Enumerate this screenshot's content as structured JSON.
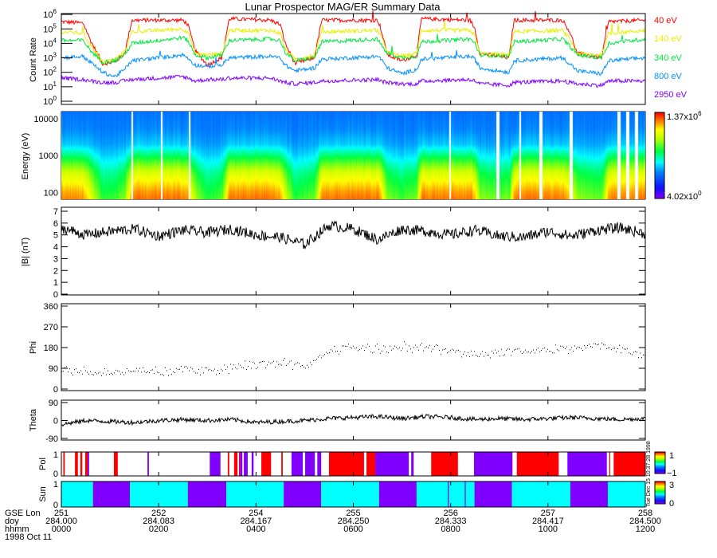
{
  "title": "Lunar Prospector MAG/ER Summary Data",
  "colors": {
    "red": "#ff0000",
    "yellow": "#e8f000",
    "green": "#00e840",
    "blue": "#0090ff",
    "purple": "#8000ff",
    "cyan": "#00ffff"
  },
  "chart_data": [
    {
      "type": "line",
      "ylabel": "Count Rate",
      "yscale": "log",
      "ylim": [
        1,
        1000000
      ],
      "ytick_base": "10",
      "ytick_exponents": [
        "0",
        "1",
        "2",
        "3",
        "4",
        "5",
        "6"
      ],
      "x_hours": [
        0,
        0.45,
        0.6,
        0.85,
        1.1,
        1.3,
        1.45,
        2.5,
        2.6,
        2.75,
        3.0,
        3.3,
        3.45,
        4.3,
        4.5,
        4.6,
        4.8,
        5.2,
        5.35,
        6.5,
        6.55,
        6.7,
        7.0,
        7.3,
        7.4,
        8.4,
        8.5,
        8.6,
        9.2,
        9.3,
        10.3,
        10.45,
        10.6,
        11.1,
        11.25,
        12
      ],
      "series": [
        {
          "name": "40 eV",
          "color": "#ff0000",
          "log10_values": [
            5.5,
            5.4,
            4.2,
            2.6,
            2.7,
            3.3,
            5.6,
            5.6,
            5.3,
            3.5,
            2.5,
            3.0,
            5.7,
            5.6,
            5.3,
            4.0,
            2.6,
            3.0,
            5.6,
            5.6,
            5.2,
            3.2,
            2.8,
            3.2,
            5.7,
            5.6,
            5.0,
            3.3,
            3.0,
            5.6,
            5.6,
            4.8,
            3.3,
            3.0,
            5.5,
            5.6
          ]
        },
        {
          "name": "140 eV",
          "color": "#e8f000",
          "log10_values": [
            4.8,
            4.7,
            3.9,
            2.7,
            2.9,
            3.4,
            4.8,
            5.0,
            4.8,
            3.3,
            3.2,
            3.3,
            4.9,
            4.9,
            4.7,
            3.6,
            2.9,
            3.2,
            4.8,
            4.9,
            4.6,
            3.4,
            3.1,
            3.3,
            4.9,
            4.9,
            4.5,
            3.3,
            3.2,
            4.8,
            4.9,
            4.3,
            3.3,
            3.2,
            4.7,
            4.9
          ]
        },
        {
          "name": "340 eV",
          "color": "#00e840",
          "log10_values": [
            4.2,
            4.2,
            3.5,
            2.7,
            2.8,
            3.2,
            4.0,
            4.4,
            4.2,
            3.2,
            3.0,
            3.2,
            4.2,
            4.3,
            4.2,
            3.4,
            2.8,
            3.0,
            4.1,
            4.3,
            4.0,
            3.3,
            3.0,
            3.1,
            4.1,
            4.3,
            4.0,
            3.2,
            3.1,
            4.1,
            4.3,
            3.8,
            3.2,
            3.0,
            4.0,
            4.3
          ]
        },
        {
          "name": "800 eV",
          "color": "#0090ff",
          "log10_values": [
            3.0,
            3.1,
            2.7,
            2.0,
            1.7,
            2.2,
            2.8,
            3.2,
            3.0,
            2.5,
            2.4,
            2.5,
            3.0,
            3.1,
            3.0,
            2.5,
            2.1,
            2.3,
            2.9,
            3.1,
            3.0,
            2.3,
            1.9,
            2.2,
            2.9,
            3.1,
            2.9,
            2.3,
            2.0,
            2.8,
            3.0,
            2.6,
            2.1,
            1.9,
            2.8,
            3.0
          ]
        },
        {
          "name": "2950 eV",
          "color": "#8000ff",
          "log10_values": [
            1.6,
            1.5,
            1.4,
            1.3,
            1.3,
            1.4,
            1.5,
            1.7,
            1.6,
            1.4,
            1.5,
            1.5,
            1.6,
            1.6,
            1.4,
            1.3,
            1.2,
            1.3,
            1.4,
            1.5,
            1.4,
            1.3,
            1.2,
            1.2,
            1.4,
            1.5,
            1.4,
            1.2,
            1.1,
            1.3,
            1.4,
            1.3,
            1.2,
            1.1,
            1.4,
            1.4
          ]
        }
      ]
    },
    {
      "type": "heatmap",
      "ylabel": "Energy (eV)",
      "yscale": "log",
      "ylim": [
        65,
        15500
      ],
      "yticks": [
        "100",
        "1000",
        "10000"
      ],
      "colorbar_max": "1.37x10",
      "colorbar_max_exp": "6",
      "colorbar_min": "4.02x10",
      "colorbar_min_exp": "0",
      "log10_energy_grid": [
        1.8,
        2.0,
        2.5,
        2.8,
        3.0,
        3.3,
        3.7,
        4.2
      ],
      "sunlit_log10_counts": [
        5.6,
        5.4,
        4.6,
        3.8,
        3.2,
        2.3,
        1.9,
        1.7
      ],
      "wake_log10_counts": [
        3.6,
        3.4,
        3.0,
        2.6,
        2.3,
        2.0,
        1.8,
        1.7
      ],
      "data_gaps_hours": [
        [
          1.43,
          1.46
        ],
        [
          2.04,
          2.07
        ],
        [
          2.61,
          2.64
        ],
        [
          7.96,
          7.99
        ],
        [
          8.93,
          9.0
        ],
        [
          9.4,
          9.43
        ],
        [
          9.82,
          9.88
        ],
        [
          10.44,
          10.5
        ],
        [
          11.42,
          11.48
        ],
        [
          11.6,
          11.67
        ],
        [
          11.78,
          11.84
        ]
      ]
    },
    {
      "type": "line",
      "ylabel": "|B| (nT)",
      "ylim": [
        0,
        7
      ],
      "yticks": [
        "0",
        "1",
        "2",
        "3",
        "4",
        "5",
        "6",
        "7"
      ],
      "x_step_hours": 0.5,
      "values": [
        5.6,
        5.0,
        5.3,
        5.5,
        4.9,
        5.4,
        5.2,
        5.5,
        5.0,
        4.8,
        4.2,
        5.8,
        5.5,
        4.6,
        5.5,
        5.3,
        5.0,
        5.4,
        4.9,
        4.8,
        5.3,
        4.9,
        5.4,
        5.6,
        5.1
      ]
    },
    {
      "type": "scatter",
      "ylabel": "Phi",
      "ylim": [
        0,
        360
      ],
      "yticks": [
        "0",
        "90",
        "180",
        "270",
        "360"
      ],
      "x_step_hours": 0.5,
      "values": [
        80,
        75,
        70,
        80,
        75,
        85,
        80,
        95,
        110,
        120,
        90,
        170,
        180,
        175,
        185,
        180,
        165,
        155,
        160,
        165,
        170,
        180,
        190,
        175,
        150
      ]
    },
    {
      "type": "line",
      "ylabel": "Theta",
      "ylim": [
        -90,
        90
      ],
      "yticks": [
        "-90",
        "0",
        "90"
      ],
      "x_step_hours": 0.5,
      "values": [
        -20,
        0,
        -5,
        -10,
        0,
        5,
        0,
        5,
        -10,
        -5,
        0,
        10,
        15,
        20,
        10,
        20,
        15,
        5,
        10,
        5,
        10,
        15,
        10,
        5,
        10
      ]
    },
    {
      "type": "bar",
      "ylabel": "Pol",
      "yticks": [
        "0",
        "1"
      ],
      "colorbar_max": "1",
      "colorbar_min": "−1",
      "segments_hours": [
        [
          0.04,
          0.07,
          1
        ],
        [
          0.28,
          0.34,
          1
        ],
        [
          0.39,
          0.43,
          1
        ],
        [
          0.49,
          0.54,
          1
        ],
        [
          0.54,
          0.57,
          -1
        ],
        [
          1.08,
          1.16,
          1
        ],
        [
          1.77,
          1.8,
          -1
        ],
        [
          3.05,
          3.27,
          -1
        ],
        [
          3.42,
          3.45,
          1
        ],
        [
          3.55,
          3.62,
          1
        ],
        [
          3.65,
          3.67,
          1
        ],
        [
          3.67,
          3.72,
          -1
        ],
        [
          3.75,
          3.83,
          -1
        ],
        [
          3.91,
          3.95,
          -1
        ],
        [
          4.11,
          4.31,
          1
        ],
        [
          4.52,
          4.55,
          1
        ],
        [
          4.73,
          4.96,
          -1
        ],
        [
          5.01,
          5.21,
          -1
        ],
        [
          5.26,
          5.34,
          -1
        ],
        [
          5.5,
          6.22,
          1
        ],
        [
          6.27,
          6.45,
          1
        ],
        [
          6.45,
          7.14,
          -1
        ],
        [
          7.19,
          7.24,
          -1
        ],
        [
          7.6,
          8.15,
          1
        ],
        [
          8.48,
          9.27,
          -1
        ],
        [
          9.36,
          10.22,
          1
        ],
        [
          10.4,
          11.21,
          -1
        ],
        [
          11.26,
          11.28,
          1
        ],
        [
          11.35,
          12,
          1
        ]
      ]
    },
    {
      "type": "bar",
      "ylabel": "Sun",
      "yticks": [
        "0",
        "1"
      ],
      "colorbar_max": "3",
      "colorbar_min": "0",
      "segments_hours": [
        [
          0,
          0.65,
          1
        ],
        [
          0.65,
          1.41,
          0
        ],
        [
          1.41,
          2.6,
          1
        ],
        [
          2.6,
          3.39,
          0
        ],
        [
          3.39,
          4.57,
          1
        ],
        [
          4.57,
          5.34,
          0
        ],
        [
          5.34,
          6.53,
          1
        ],
        [
          6.53,
          7.3,
          0
        ],
        [
          7.3,
          8.49,
          1
        ],
        [
          7.94,
          7.96,
          0
        ],
        [
          8.29,
          8.31,
          0
        ],
        [
          8.49,
          9.26,
          0
        ],
        [
          9.26,
          10.46,
          1
        ],
        [
          10.46,
          11.23,
          0
        ],
        [
          11.23,
          12,
          1
        ]
      ]
    }
  ],
  "xaxis": {
    "row_labels": [
      "GSE Lon",
      "doy",
      "hhmm"
    ],
    "tick_hours": [
      0,
      2,
      4,
      6,
      8,
      10,
      12
    ],
    "gse_lon": [
      "251",
      "252",
      "254",
      "255",
      "256",
      "257",
      "258"
    ],
    "doy": [
      "284.000",
      "284.083",
      "284.167",
      "284.250",
      "284.333",
      "284.417",
      "284.500"
    ],
    "hhmm": [
      "0000",
      "0200",
      "0400",
      "0600",
      "0800",
      "1000",
      "1200"
    ],
    "date": "1998 Oct 11"
  },
  "stamp": "Tue Dec 15 10:37:28 1998"
}
